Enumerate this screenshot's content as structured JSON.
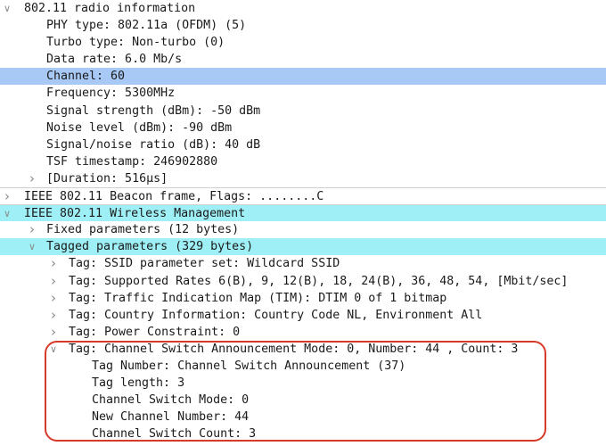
{
  "packet_tree": [
    {
      "id": "radio-info",
      "depth": 0,
      "toggle": "expanded",
      "label": "802.11 radio information",
      "highlight": ""
    },
    {
      "id": "phy-type",
      "depth": 1,
      "toggle": "none",
      "label": "PHY type: 802.11a (OFDM) (5)",
      "highlight": ""
    },
    {
      "id": "turbo-type",
      "depth": 1,
      "toggle": "none",
      "label": "Turbo type: Non-turbo (0)",
      "highlight": ""
    },
    {
      "id": "data-rate",
      "depth": 1,
      "toggle": "none",
      "label": "Data rate: 6.0 Mb/s",
      "highlight": ""
    },
    {
      "id": "channel",
      "depth": 1,
      "toggle": "none",
      "label": "Channel: 60",
      "highlight": "selected"
    },
    {
      "id": "frequency",
      "depth": 1,
      "toggle": "none",
      "label": "Frequency: 5300MHz",
      "highlight": ""
    },
    {
      "id": "signal-strength",
      "depth": 1,
      "toggle": "none",
      "label": "Signal strength (dBm): -50 dBm",
      "highlight": ""
    },
    {
      "id": "noise-level",
      "depth": 1,
      "toggle": "none",
      "label": "Noise level (dBm): -90 dBm",
      "highlight": ""
    },
    {
      "id": "snr",
      "depth": 1,
      "toggle": "none",
      "label": "Signal/noise ratio (dB): 40 dB",
      "highlight": ""
    },
    {
      "id": "tsf-timestamp",
      "depth": 1,
      "toggle": "none",
      "label": "TSF timestamp: 246902880",
      "highlight": ""
    },
    {
      "id": "duration",
      "depth": 1,
      "toggle": "collapsed",
      "label": "[Duration: 516µs]",
      "highlight": ""
    },
    {
      "id": "beacon-frame",
      "depth": 0,
      "toggle": "collapsed",
      "label": "IEEE 802.11 Beacon frame, Flags: ........C",
      "highlight": ""
    },
    {
      "id": "wireless-mgmt",
      "depth": 0,
      "toggle": "expanded",
      "label": "IEEE 802.11 Wireless Management",
      "highlight": "cyan"
    },
    {
      "id": "fixed-params",
      "depth": 1,
      "toggle": "collapsed",
      "label": "Fixed parameters (12 bytes)",
      "highlight": ""
    },
    {
      "id": "tagged-params",
      "depth": 1,
      "toggle": "expanded",
      "label": "Tagged parameters (329 bytes)",
      "highlight": "cyan"
    },
    {
      "id": "tag-ssid",
      "depth": 2,
      "toggle": "collapsed",
      "label": "Tag: SSID parameter set: Wildcard SSID",
      "highlight": ""
    },
    {
      "id": "tag-rates",
      "depth": 2,
      "toggle": "collapsed",
      "label": "Tag: Supported Rates 6(B), 9, 12(B), 18, 24(B), 36, 48, 54, [Mbit/sec]",
      "highlight": ""
    },
    {
      "id": "tag-tim",
      "depth": 2,
      "toggle": "collapsed",
      "label": "Tag: Traffic Indication Map (TIM): DTIM 0 of 1 bitmap",
      "highlight": ""
    },
    {
      "id": "tag-country",
      "depth": 2,
      "toggle": "collapsed",
      "label": "Tag: Country Information: Country Code NL, Environment All",
      "highlight": ""
    },
    {
      "id": "tag-power",
      "depth": 2,
      "toggle": "collapsed",
      "label": "Tag: Power Constraint: 0",
      "highlight": ""
    },
    {
      "id": "tag-csa",
      "depth": 2,
      "toggle": "expanded",
      "label": "Tag: Channel Switch Announcement Mode: 0, Number: 44 , Count: 3",
      "highlight": ""
    },
    {
      "id": "csa-tag-number",
      "depth": 3,
      "toggle": "none",
      "label": "Tag Number: Channel Switch Announcement (37)",
      "highlight": ""
    },
    {
      "id": "csa-tag-length",
      "depth": 3,
      "toggle": "none",
      "label": "Tag length: 3",
      "highlight": ""
    },
    {
      "id": "csa-mode",
      "depth": 3,
      "toggle": "none",
      "label": "Channel Switch Mode: 0",
      "highlight": ""
    },
    {
      "id": "csa-new-channel",
      "depth": 3,
      "toggle": "none",
      "label": "New Channel Number: 44",
      "highlight": ""
    },
    {
      "id": "csa-count",
      "depth": 3,
      "toggle": "none",
      "label": "Channel Switch Count: 3",
      "highlight": ""
    }
  ],
  "icons": {
    "expanded": "chevron-down-icon",
    "collapsed": "chevron-right-icon"
  },
  "colors": {
    "selected_row": "#a8c8f5",
    "cyan_row": "#9ff0f6",
    "annotation_box": "#d63b2a"
  }
}
